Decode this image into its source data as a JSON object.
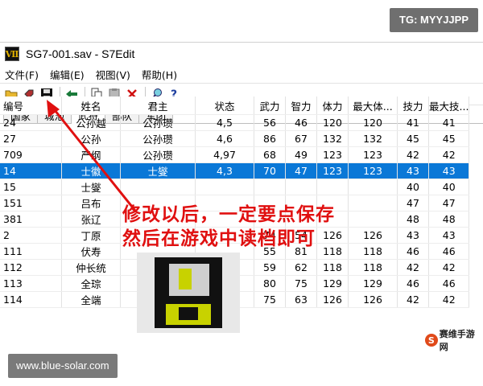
{
  "badge": {
    "text": "TG: MYYJJPP"
  },
  "window": {
    "app_icon_text": "Ⅶ",
    "title": "SG7-001.sav - S7Edit"
  },
  "menu": {
    "items": [
      "文件(F)",
      "编辑(E)",
      "视图(V)",
      "帮助(H)"
    ]
  },
  "toolbar": {
    "icons": [
      "open-icon",
      "tag-icon",
      "save-icon",
      "back-arrow-icon",
      "copy-icon",
      "paste-icon",
      "delete-icon",
      "search-icon",
      "help-icon"
    ]
  },
  "tabs": [
    "国家",
    "城池",
    "武将",
    "部队",
    "军团"
  ],
  "table": {
    "headers": [
      "编号",
      "姓名",
      "君主",
      "状态",
      "武力",
      "智力",
      "体力",
      "最大体...",
      "技力",
      "最大技..."
    ],
    "rows": [
      [
        "24",
        "公孙越",
        "公孙瓒",
        "4,5",
        "56",
        "46",
        "120",
        "120",
        "41",
        "41"
      ],
      [
        "27",
        "公孙",
        "公孙瓒",
        "4,6",
        "86",
        "67",
        "132",
        "132",
        "45",
        "45"
      ],
      [
        "709",
        "严纲",
        "公孙瓒",
        "4,97",
        "68",
        "49",
        "123",
        "123",
        "42",
        "42"
      ],
      [
        "14",
        "士徽",
        "士燮",
        "4,3",
        "70",
        "47",
        "123",
        "123",
        "43",
        "43"
      ],
      [
        "15",
        "士燮",
        "",
        "",
        "",
        "",
        "",
        "",
        "40",
        "40"
      ],
      [
        "151",
        "吕布",
        "",
        "",
        "",
        "",
        "",
        "",
        "47",
        "47"
      ],
      [
        "381",
        "张辽",
        "",
        "",
        "",
        "",
        "",
        "",
        "48",
        "48"
      ],
      [
        "2",
        "丁原",
        "",
        "",
        "74",
        "54",
        "126",
        "126",
        "43",
        "43"
      ],
      [
        "111",
        "伏寿",
        "",
        "",
        "55",
        "81",
        "118",
        "118",
        "46",
        "46"
      ],
      [
        "112",
        "仲长统",
        "",
        "",
        "59",
        "62",
        "118",
        "118",
        "42",
        "42"
      ],
      [
        "113",
        "全琮",
        "",
        "",
        "80",
        "75",
        "129",
        "129",
        "46",
        "46"
      ],
      [
        "114",
        "全端",
        "",
        "",
        "75",
        "63",
        "126",
        "126",
        "42",
        "42"
      ]
    ],
    "selected_row": 3
  },
  "annotation": {
    "line1": "修改以后，一定要点保存",
    "line2": "然后在游戏中读档即可"
  },
  "colors": {
    "selection": "#0a78d7",
    "annotation": "#e01010",
    "floppy_label": "#c8d200"
  },
  "footer": {
    "watermark": "www.blue-solar.com",
    "logo_mark": "S",
    "logo_text": "赛维手游网"
  }
}
